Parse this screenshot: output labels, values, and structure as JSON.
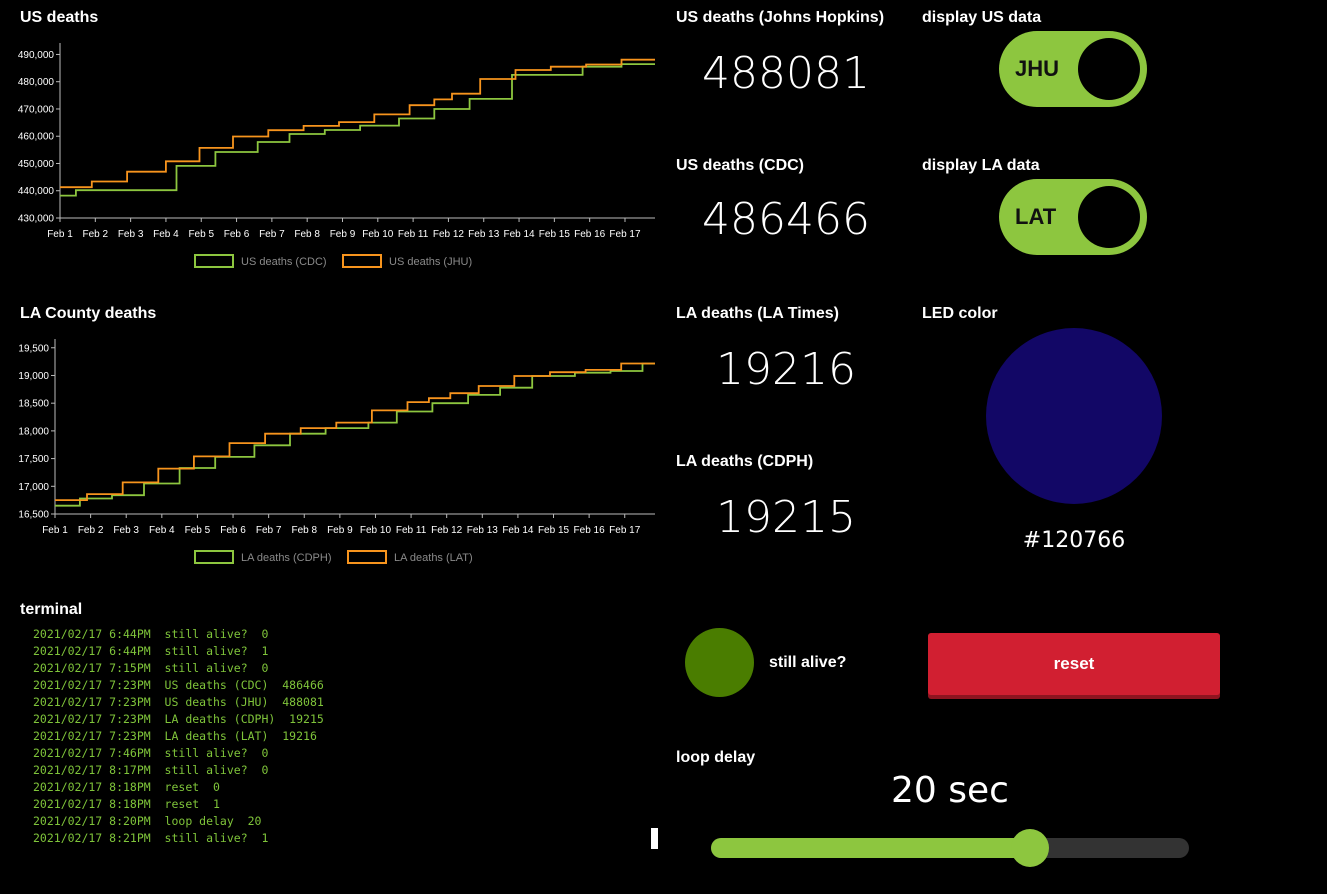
{
  "colors": {
    "green": "#8dc63f",
    "orange": "#f7941d",
    "led": "#120766",
    "alive": "#4a7d00",
    "reset": "#d11f31",
    "terminal_text": "#7fc43a",
    "axis": "#bbbbbb",
    "legend_text": "#8a8a8a"
  },
  "us_chart": {
    "title": "US deaths"
  },
  "la_chart": {
    "title": "LA County deaths"
  },
  "chart_data": [
    {
      "type": "line",
      "title": "US deaths",
      "step": true,
      "x": [
        "Feb 1",
        "Feb 2",
        "Feb 3",
        "Feb 4",
        "Feb 5",
        "Feb 6",
        "Feb 7",
        "Feb 8",
        "Feb 9",
        "Feb 10",
        "Feb 11",
        "Feb 12",
        "Feb 13",
        "Feb 14",
        "Feb 15",
        "Feb 16",
        "Feb 17"
      ],
      "xlim": [
        1,
        17.85
      ],
      "ylim": [
        430000,
        492000
      ],
      "yticks": [
        430000,
        440000,
        450000,
        460000,
        470000,
        480000,
        490000
      ],
      "ytick_labels": [
        "430,000",
        "440,000",
        "450,000",
        "460,000",
        "470,000",
        "480,000",
        "490,000"
      ],
      "legend_position": "bottom",
      "series": [
        {
          "name": "US deaths (CDC)",
          "color": "#8dc63f",
          "points": [
            [
              1,
              438200
            ],
            [
              1.45,
              440200
            ],
            [
              4.3,
              449100
            ],
            [
              5.4,
              454200
            ],
            [
              6.6,
              457900
            ],
            [
              7.5,
              460800
            ],
            [
              8.5,
              462300
            ],
            [
              9.5,
              463900
            ],
            [
              10.6,
              466500
            ],
            [
              11.6,
              470000
            ],
            [
              12.6,
              473700
            ],
            [
              13.8,
              482500
            ],
            [
              15.8,
              485500
            ],
            [
              16.9,
              486466
            ],
            [
              17.85,
              486466
            ]
          ]
        },
        {
          "name": "US deaths (JHU)",
          "color": "#f7941d",
          "points": [
            [
              1,
              441300
            ],
            [
              1.9,
              443400
            ],
            [
              2.9,
              447000
            ],
            [
              4.0,
              450800
            ],
            [
              4.95,
              455700
            ],
            [
              5.9,
              459900
            ],
            [
              6.9,
              462200
            ],
            [
              7.9,
              463800
            ],
            [
              8.9,
              465200
            ],
            [
              9.9,
              468000
            ],
            [
              10.9,
              471400
            ],
            [
              11.6,
              473500
            ],
            [
              12.1,
              475600
            ],
            [
              12.9,
              481000
            ],
            [
              13.9,
              484300
            ],
            [
              14.9,
              485500
            ],
            [
              15.9,
              486300
            ],
            [
              16.9,
              488081
            ],
            [
              17.85,
              488081
            ]
          ]
        }
      ]
    },
    {
      "type": "line",
      "title": "LA County deaths",
      "step": true,
      "x": [
        "Feb 1",
        "Feb 2",
        "Feb 3",
        "Feb 4",
        "Feb 5",
        "Feb 6",
        "Feb 7",
        "Feb 8",
        "Feb 9",
        "Feb 10",
        "Feb 11",
        "Feb 12",
        "Feb 13",
        "Feb 14",
        "Feb 15",
        "Feb 16",
        "Feb 17"
      ],
      "xlim": [
        1,
        17.85
      ],
      "ylim": [
        16500,
        19550
      ],
      "yticks": [
        16500,
        17000,
        17500,
        18000,
        18500,
        19000,
        19500
      ],
      "ytick_labels": [
        "16,500",
        "17,000",
        "17,500",
        "18,000",
        "18,500",
        "19,000",
        "19,500"
      ],
      "legend_position": "bottom",
      "series": [
        {
          "name": "LA deaths (CDPH)",
          "color": "#8dc63f",
          "points": [
            [
              1,
              16650
            ],
            [
              1.7,
              16780
            ],
            [
              2.6,
              16840
            ],
            [
              3.5,
              17050
            ],
            [
              4.5,
              17330
            ],
            [
              5.5,
              17530
            ],
            [
              6.6,
              17740
            ],
            [
              7.6,
              17950
            ],
            [
              8.6,
              18050
            ],
            [
              9.8,
              18150
            ],
            [
              10.6,
              18350
            ],
            [
              11.6,
              18500
            ],
            [
              12.6,
              18650
            ],
            [
              13.5,
              18780
            ],
            [
              14.4,
              18990
            ],
            [
              15.6,
              19050
            ],
            [
              16.6,
              19080
            ],
            [
              17.5,
              19215
            ],
            [
              17.85,
              19215
            ]
          ]
        },
        {
          "name": "LA deaths (LAT)",
          "color": "#f7941d",
          "points": [
            [
              1,
              16750
            ],
            [
              1.9,
              16860
            ],
            [
              2.9,
              17070
            ],
            [
              3.9,
              17320
            ],
            [
              4.9,
              17540
            ],
            [
              5.9,
              17780
            ],
            [
              6.9,
              17950
            ],
            [
              7.9,
              18050
            ],
            [
              8.9,
              18150
            ],
            [
              9.9,
              18370
            ],
            [
              10.9,
              18520
            ],
            [
              11.5,
              18590
            ],
            [
              12.1,
              18680
            ],
            [
              12.9,
              18810
            ],
            [
              13.9,
              18990
            ],
            [
              14.9,
              19060
            ],
            [
              15.9,
              19100
            ],
            [
              16.9,
              19216
            ],
            [
              17.85,
              19216
            ]
          ]
        }
      ]
    }
  ],
  "stats": {
    "jhu_label": "US deaths (Johns Hopkins)",
    "jhu_value": "488081",
    "cdc_label": "US deaths (CDC)",
    "cdc_value": "486466",
    "lat_label": "LA deaths (LA Times)",
    "lat_value": "19216",
    "cdph_label": "LA deaths (CDPH)",
    "cdph_value": "19215"
  },
  "toggles": {
    "us_title": "display US data",
    "us_label": "JHU",
    "la_title": "display LA data",
    "la_label": "LAT"
  },
  "led": {
    "title": "LED color",
    "hex": "#120766"
  },
  "alive": {
    "label": "still alive?"
  },
  "reset": {
    "label": "reset"
  },
  "terminal": {
    "title": "terminal",
    "lines": [
      "2021/02/17 6:44PM  still alive?  0",
      "2021/02/17 6:44PM  still alive?  1",
      "2021/02/17 7:15PM  still alive?  0",
      "2021/02/17 7:23PM  US deaths (CDC)  486466",
      "2021/02/17 7:23PM  US deaths (JHU)  488081",
      "2021/02/17 7:23PM  LA deaths (CDPH)  19215",
      "2021/02/17 7:23PM  LA deaths (LAT)  19216",
      "2021/02/17 7:46PM  still alive?  0",
      "2021/02/17 8:17PM  still alive?  0",
      "2021/02/17 8:18PM  reset  0",
      "2021/02/17 8:18PM  reset  1",
      "2021/02/17 8:20PM  loop delay  20",
      "2021/02/17 8:21PM  still alive?  1"
    ]
  },
  "loop_delay": {
    "title": "loop delay",
    "value_text": "20 sec",
    "value": 20,
    "min": 0,
    "max": 30
  }
}
